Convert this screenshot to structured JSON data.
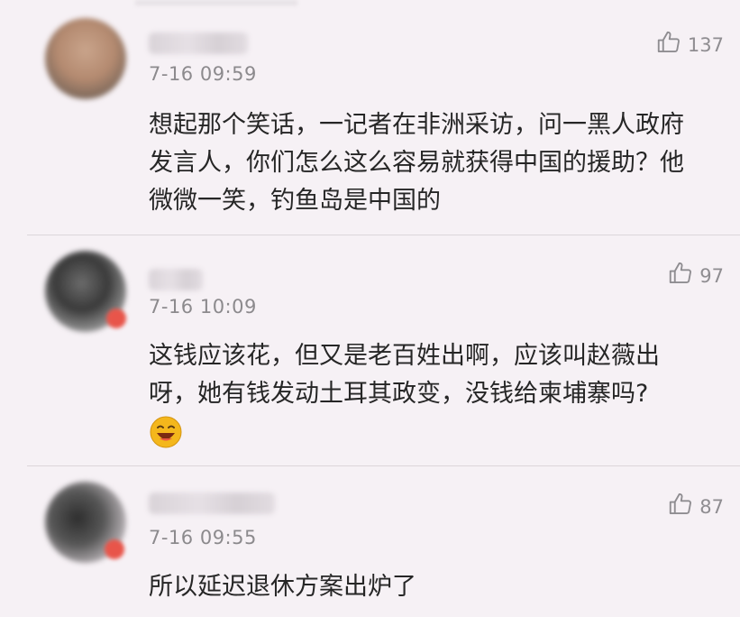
{
  "comments": [
    {
      "timestamp": "7-16 09:59",
      "likes": "137",
      "text_lines": [
        "想起那个笑话，一记者在非洲采访，问一黑人政府",
        "发言人，你们怎么这么容易就获得中国的援助？他",
        "微微一笑，钓鱼岛是中国的"
      ]
    },
    {
      "timestamp": "7-16 10:09",
      "likes": "97",
      "text_lines": [
        "这钱应该花，但又是老百姓出啊，应该叫赵薇出",
        "呀，她有钱发动土耳其政变，没钱给柬埔寨吗?"
      ],
      "emoji": "laughing-emoji"
    },
    {
      "timestamp": "7-16 09:55",
      "likes": "87",
      "text_lines": [
        "所以延迟退休方案出炉了"
      ]
    }
  ],
  "icons": {
    "like": "thumbs-up-icon",
    "emoji": "laughing-face-emoji"
  },
  "colors": {
    "background": "#f6f1f5",
    "meta_text": "#8c8a8d",
    "body_text": "#262626",
    "emoji_yellow": "#f4b71c"
  }
}
